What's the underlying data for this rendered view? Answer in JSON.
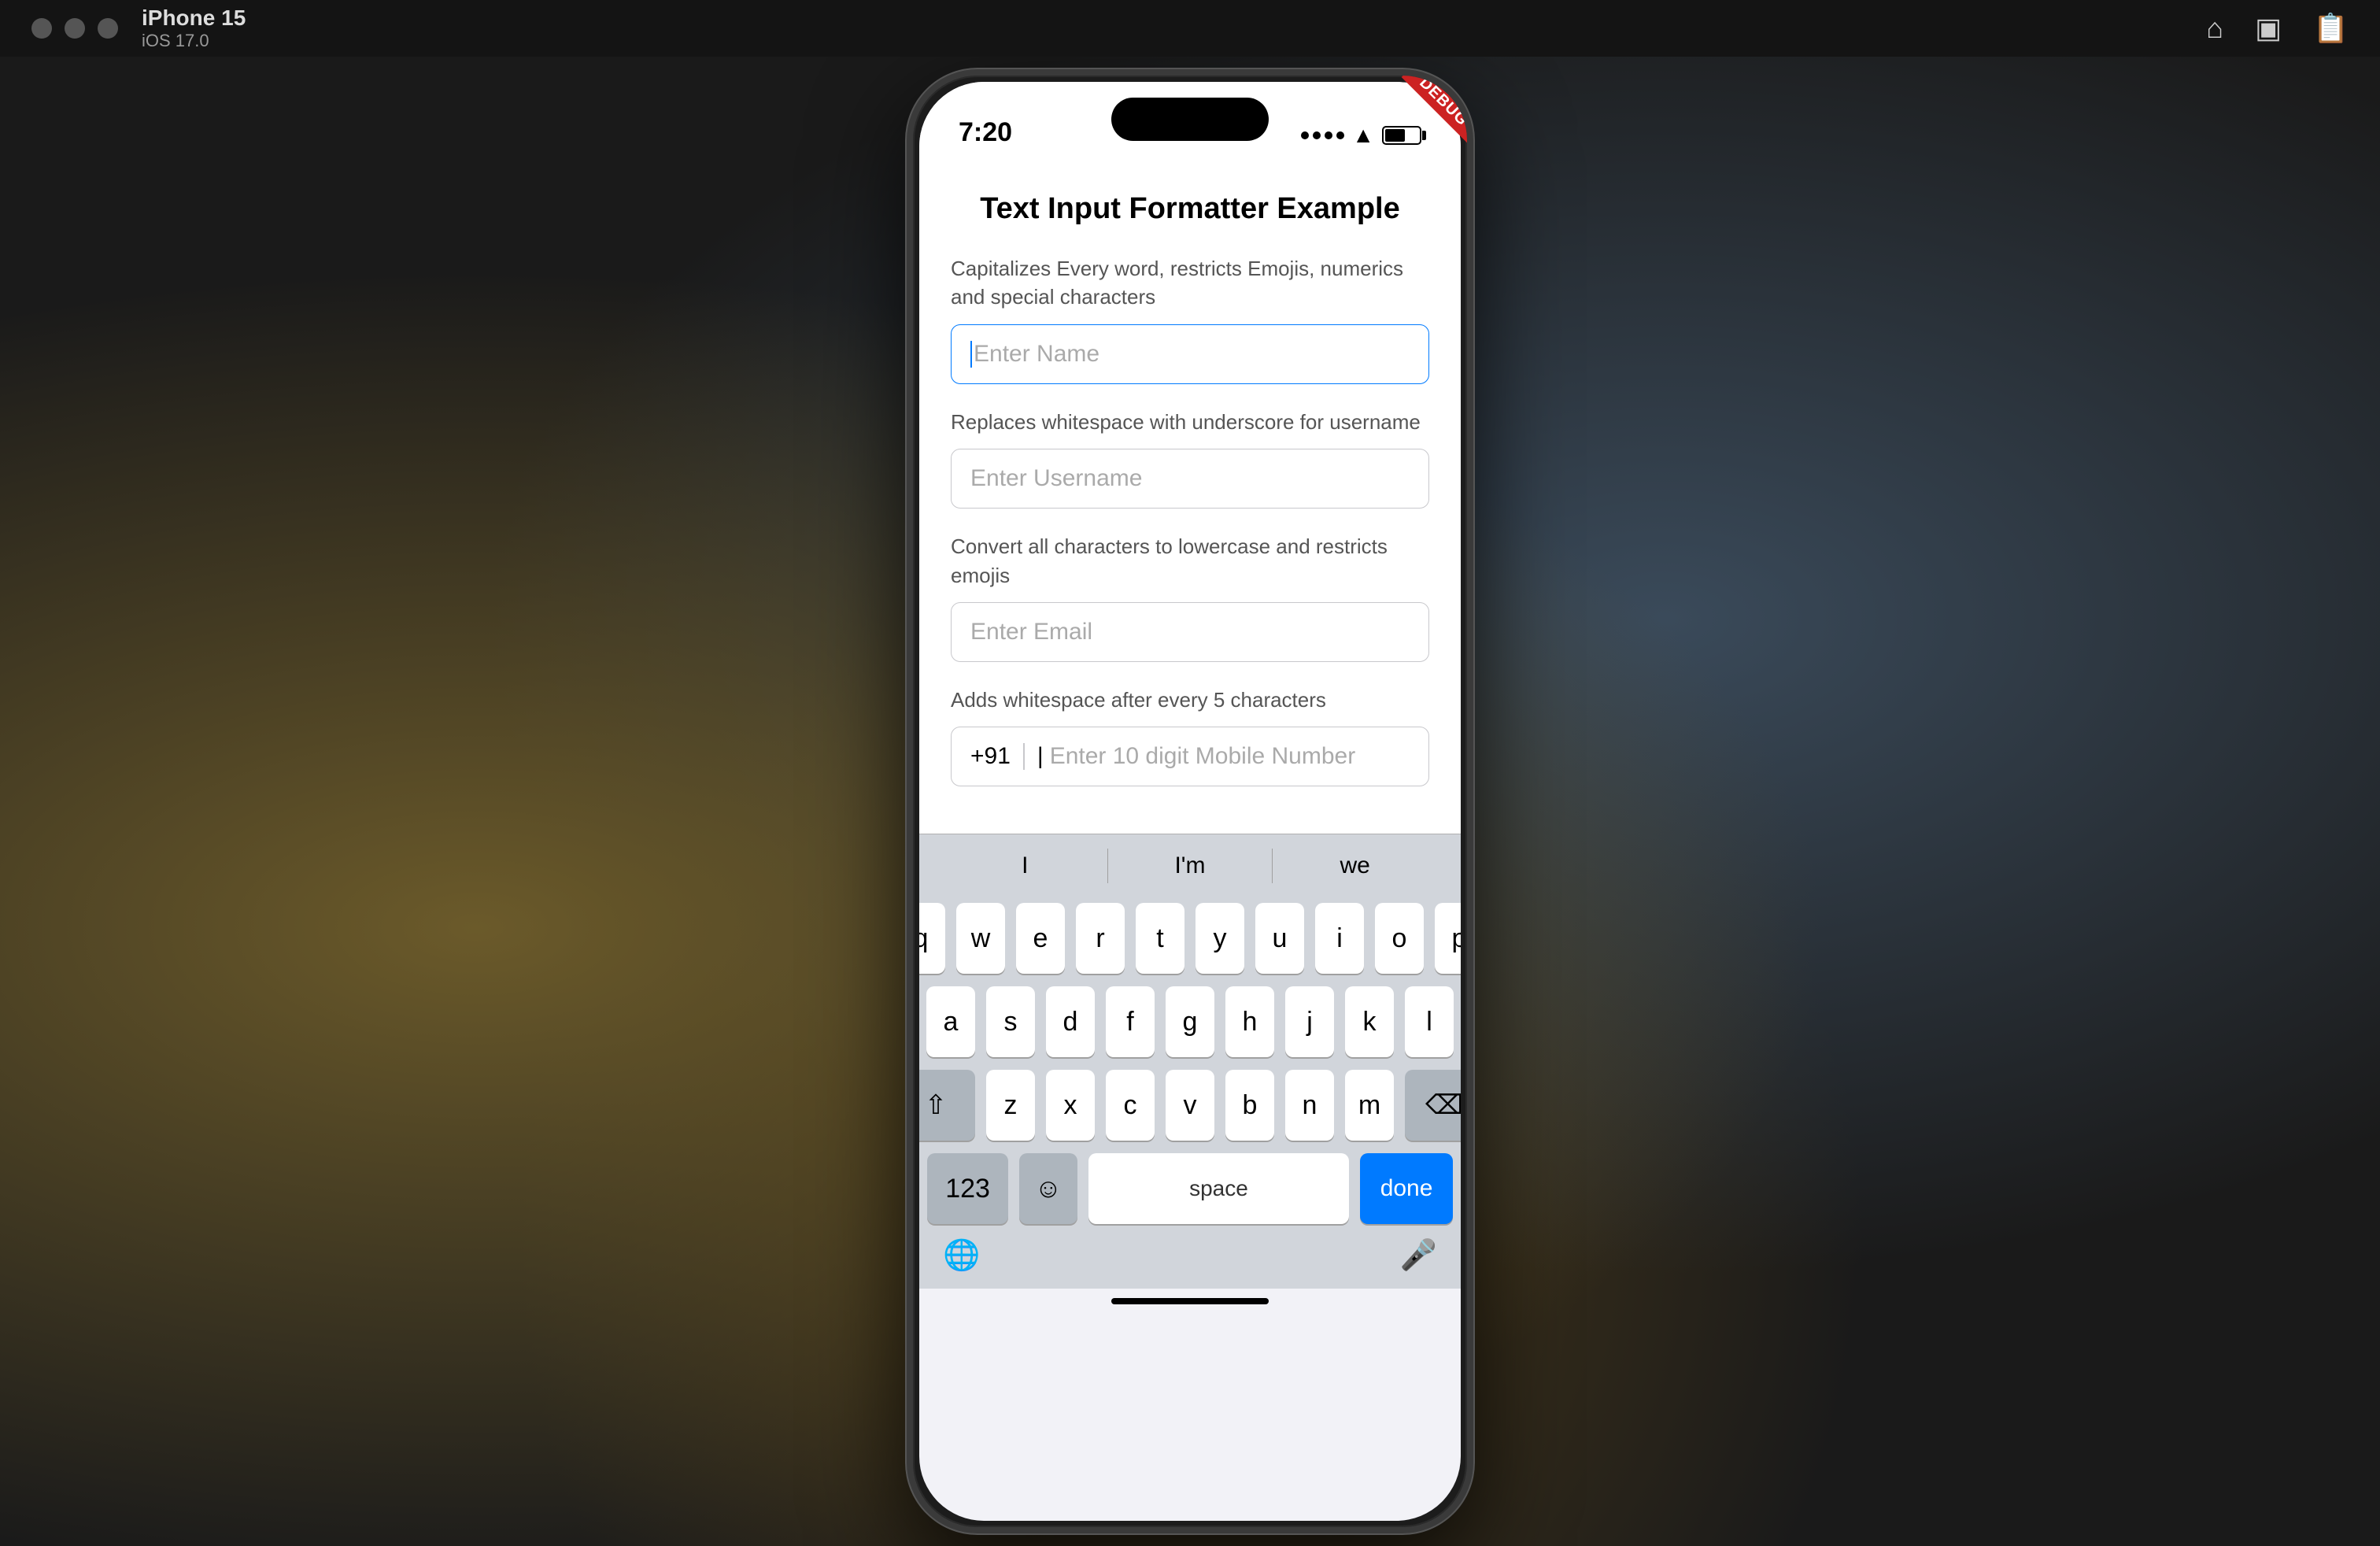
{
  "menuBar": {
    "dots": [
      "dot1",
      "dot2",
      "dot3"
    ],
    "deviceName": "iPhone 15",
    "osVersion": "iOS 17.0",
    "icons": {
      "home": "⌂",
      "screenshot": "📷",
      "clipboard": "📋"
    }
  },
  "debugBadge": "DEBUG",
  "statusBar": {
    "time": "7:20",
    "signal": "...",
    "wifi": "wifi",
    "battery": "battery"
  },
  "app": {
    "title": "Text Input Formatter Example",
    "fields": [
      {
        "description": "Capitalizes Every word, restricts Emojis, numerics and special characters",
        "placeholder": "Enter Name",
        "isActive": true,
        "hasCursor": true
      },
      {
        "description": "Replaces whitespace with underscore for username",
        "placeholder": "Enter Username",
        "isActive": false,
        "hasCursor": false
      },
      {
        "description": "Convert all characters to lowercase and restricts emojis",
        "placeholder": "Enter Email",
        "isActive": false,
        "hasCursor": false
      },
      {
        "description": "Adds whitespace after every 5 characters",
        "placeholder": "Enter 10 digit Mobile Number",
        "prefix": "+91",
        "isActive": false,
        "hasCursor": false
      }
    ]
  },
  "autocomplete": {
    "items": [
      "I",
      "I'm",
      "we"
    ]
  },
  "keyboard": {
    "rows": [
      [
        "q",
        "w",
        "e",
        "r",
        "t",
        "y",
        "u",
        "i",
        "o",
        "p"
      ],
      [
        "a",
        "s",
        "d",
        "f",
        "g",
        "h",
        "j",
        "k",
        "l"
      ],
      [
        "⇧",
        "z",
        "x",
        "c",
        "v",
        "b",
        "n",
        "m",
        "⌫"
      ],
      [
        "123",
        "☺",
        "space",
        "done"
      ]
    ],
    "spaceLabel": "space",
    "doneLabel": "done",
    "numLabel": "123",
    "emojiLabel": "☺",
    "globeIcon": "🌐",
    "micIcon": "🎤"
  }
}
